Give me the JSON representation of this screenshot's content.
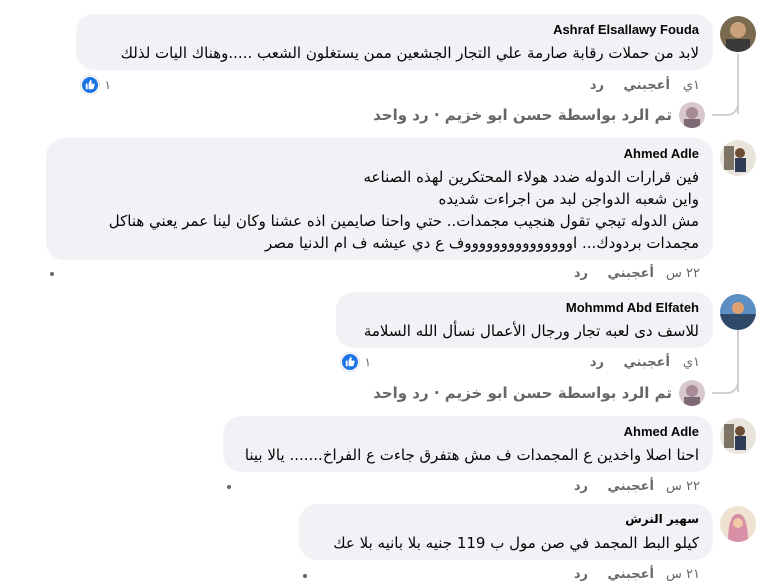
{
  "top_actions": {
    "time": "١ي",
    "like": "أعجبني",
    "reply": "رد"
  },
  "comments": [
    {
      "author": "Ashraf Elsallawy Fouda",
      "text": [
        "لابد من حملات رقابة صارمة علي التجار الجشعين ممن يستغلون الشعب .....وهناك اليات لذلك"
      ],
      "time": "١ي",
      "like_label": "أعجبني",
      "reply_label": "رد",
      "reactions": {
        "count": "١",
        "type": "like"
      },
      "reply_summary": "تم الرد بواسطة حسن ابو خزيم · رد واحد"
    },
    {
      "author": "Ahmed Adle",
      "text": [
        "فين قرارات الدوله ضدد هولاء المحتكرين لهذه الصناعه",
        "واين شعبه الدواجن لبد من اجراءت شديده",
        "مش الدوله تيجي تقول هنجيب مجمدات.. حتي واحنا صايمين اذه عشنا وكان لينا عمر يعني هناكل",
        "مجمدات بردودك... اوووووووووووووووف ع دي عيشه ف ام الدنيا مصر"
      ],
      "time": "٢٢ س",
      "like_label": "أعجبني",
      "reply_label": "رد"
    },
    {
      "author": "Mohmmd Abd Elfateh",
      "text": [
        "للاسف دى لعبه تجار ورجال الأعمال نسأل الله السلامة"
      ],
      "time": "١ي",
      "like_label": "أعجبني",
      "reply_label": "رد",
      "reactions": {
        "count": "١",
        "type": "like"
      },
      "reply_summary": "تم الرد بواسطة حسن ابو خزيم · رد واحد"
    },
    {
      "author": "Ahmed Adle",
      "text": [
        "احنا اصلا واخدين ع المجمدات ف مش هتفرق جاءت ع الفراخ....... يالا بينا"
      ],
      "time": "٢٢ س",
      "like_label": "أعجبني",
      "reply_label": "رد"
    },
    {
      "author": "سهير النرش",
      "text": [
        "كيلو البط المجمد في صن مول ب 119 جنيه بلا بانيه بلا عك"
      ],
      "time": "٢١ س",
      "like_label": "أعجبني",
      "reply_label": "رد"
    }
  ],
  "colors": {
    "bubble_bg": "#f0f2f5",
    "meta_text": "#65676b",
    "like_blue": "#1b74e4",
    "thread_line": "#ced0d4"
  }
}
